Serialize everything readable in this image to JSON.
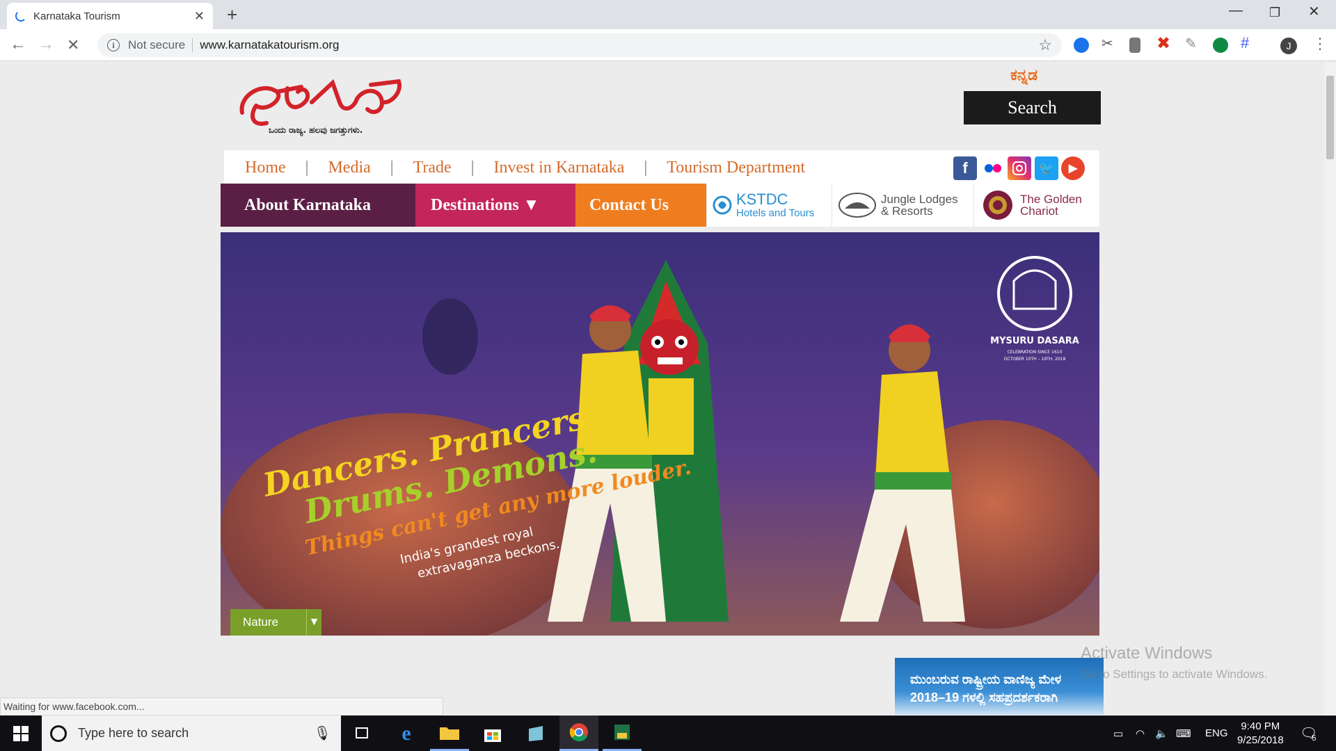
{
  "browser": {
    "tab_title": "Karnataka Tourism",
    "tab_close": "✕",
    "new_tab": "+",
    "not_secure": "Not secure",
    "url": "www.karnatakatourism.org"
  },
  "site": {
    "language_link": "ಕನ್ನಡ",
    "search_label": "Search",
    "logo_tagline": "ಒಂದು ರಾಜ್ಯ. ಹಲವು ಜಗತ್ತುಗಳು.",
    "top_nav": [
      "Home",
      "Media",
      "Trade",
      "Invest in Karnataka",
      "Tourism Department"
    ],
    "main_nav": {
      "about": "About Karnataka",
      "destinations": "Destinations ▼",
      "contact": "Contact Us"
    },
    "partners": {
      "kstdc_1": "KSTDC",
      "kstdc_2": "Hotels and Tours",
      "jungle_1": "Jungle Lodges",
      "jungle_2": "& Resorts",
      "chariot_1": "The Golden",
      "chariot_2": "Chariot"
    },
    "hero": {
      "line1": "Dancers. Prancers.",
      "line2": "Drums. Demons.",
      "line3": "Things can't get any more louder.",
      "line4": "India's grandest royal",
      "line5": "extravaganza beckons.",
      "badge_title": "MYSURU DASARA",
      "badge_sub": "CELEBRATION SINCE 1610",
      "badge_dates": "OCTOBER 10TH – 19TH, 2018"
    },
    "nature_dropdown": "Nature",
    "banner_line1": "ಮುಂಬರುವ ರಾಷ್ಟ್ರೀಯ ವಾಣಿಜ್ಯ ಮೇಳ",
    "banner_line2": "2018–19 ಗಳಲ್ಲಿ ಸಹಪ್ರದರ್ಶಕರಾಗಿ"
  },
  "status_text": "Waiting for www.facebook.com...",
  "watermark": {
    "line1": "Activate Windows",
    "line2": "Go to Settings to activate Windows."
  },
  "taskbar": {
    "search_placeholder": "Type here to search",
    "lang": "ENG",
    "time": "9:40 PM",
    "date": "9/25/2018",
    "notif_count": "5"
  },
  "colors": {
    "about_bg": "#5b1f45",
    "destinations_bg": "#c4265c",
    "contact_bg": "#ef7d1f",
    "nav_link": "#d46b2b",
    "nature_bg": "#7aa02a"
  }
}
